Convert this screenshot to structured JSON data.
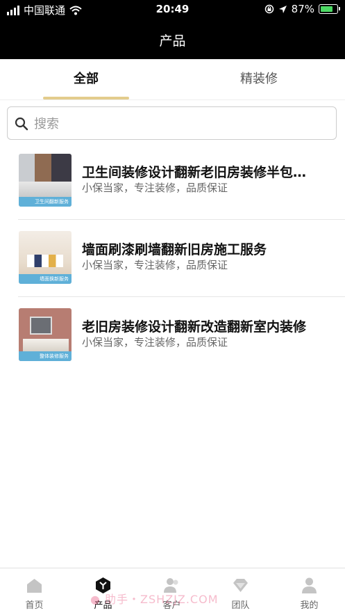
{
  "status_bar": {
    "carrier": "中国联通",
    "time": "20:49",
    "battery_percent": "87%",
    "battery_level": 0.87,
    "icons": [
      "signal-icon",
      "wifi-icon",
      "orientation-lock-icon",
      "location-arrow-icon",
      "battery-icon"
    ]
  },
  "nav": {
    "title": "产品"
  },
  "tabs": [
    {
      "label": "全部",
      "active": true
    },
    {
      "label": "精装修",
      "active": false
    }
  ],
  "search": {
    "placeholder": "搜索",
    "value": ""
  },
  "products": [
    {
      "title": "卫生间装修设计翻新老旧房装修半包…",
      "subtitle": "小保当家，专注装修，品质保证",
      "thumb_banner": "卫生间翻新服务"
    },
    {
      "title": "墙面刷漆刷墙翻新旧房施工服务",
      "subtitle": "小保当家，专注装修，品质保证",
      "thumb_banner": "墙面换新服务"
    },
    {
      "title": "老旧房装修设计翻新改造翻新室内装修",
      "subtitle": "小保当家，专注装修，品质保证",
      "thumb_banner": "整体装修服务"
    }
  ],
  "tabbar": [
    {
      "label": "首页",
      "icon": "home-icon",
      "active": false
    },
    {
      "label": "产品",
      "icon": "product-icon",
      "active": true
    },
    {
      "label": "客户",
      "icon": "customer-icon",
      "active": false
    },
    {
      "label": "团队",
      "icon": "team-icon",
      "active": false
    },
    {
      "label": "我的",
      "icon": "profile-icon",
      "active": false
    }
  ],
  "watermark": "● 助手・ZSHZJZ.COM",
  "colors": {
    "accent": "#e3cc8c",
    "header": "#000000",
    "battery": "#4cd964",
    "thumb_banner": "#5fb0d8"
  }
}
